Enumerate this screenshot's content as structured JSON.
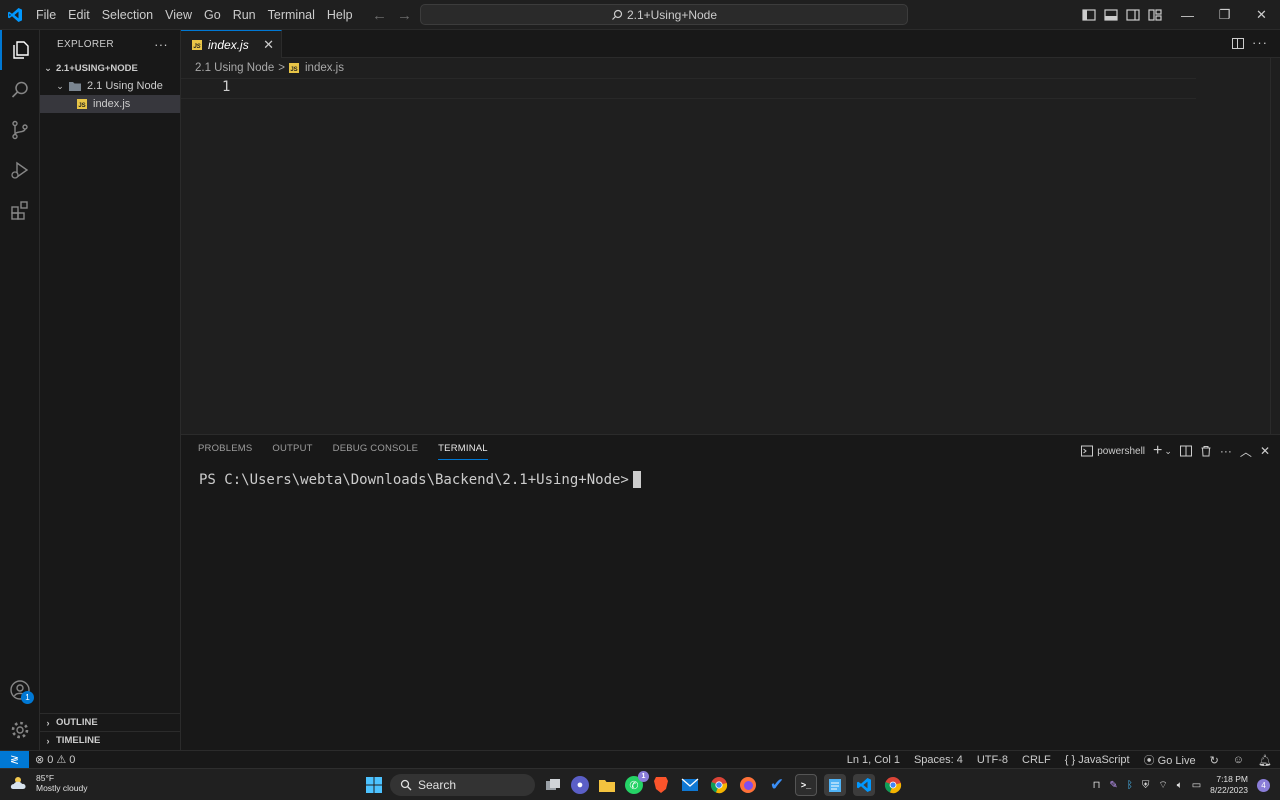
{
  "titlebar": {
    "menu": [
      "File",
      "Edit",
      "Selection",
      "View",
      "Go",
      "Run",
      "Terminal",
      "Help"
    ],
    "command_center": "2.1+Using+Node",
    "nav_back": "←",
    "nav_forward": "→",
    "minimize": "—",
    "maximize": "❐",
    "close": "✕"
  },
  "activitybar": {
    "account_badge": "1"
  },
  "sidebar": {
    "title": "EXPLORER",
    "more": "···",
    "root_folder": "2.1+USING+NODE",
    "subfolder": "2.1 Using Node",
    "file": "index.js",
    "outline": "OUTLINE",
    "timeline": "TIMELINE"
  },
  "editor": {
    "tab_label": "index.js",
    "tab_close": "✕",
    "breadcrumb_folder": "2.1 Using Node",
    "breadcrumb_sep": ">",
    "breadcrumb_file": "index.js",
    "line_number": "1",
    "file_badge": "JS"
  },
  "panel": {
    "tabs": [
      "PROBLEMS",
      "OUTPUT",
      "DEBUG CONSOLE",
      "TERMINAL"
    ],
    "active_tab": "TERMINAL",
    "shell_label": "powershell",
    "terminal_prompt": "PS C:\\Users\\webta\\Downloads\\Backend\\2.1+Using+Node>"
  },
  "statusbar": {
    "errors": "0",
    "warnings": "0",
    "position": "Ln 1, Col 1",
    "spaces": "Spaces: 4",
    "encoding": "UTF-8",
    "eol": "CRLF",
    "language": "JavaScript",
    "go_live": "Go Live"
  },
  "taskbar": {
    "temperature": "85°F",
    "weather": "Mostly cloudy",
    "search": "Search",
    "time": "7:18 PM",
    "date": "8/22/2023",
    "notification_count": "4",
    "whatsapp_badge": "1"
  },
  "colors": {
    "accent": "#0078d4",
    "js_badge": "#e8c547",
    "editor_bg": "#1f1f1f",
    "sidebar_bg": "#181818"
  }
}
